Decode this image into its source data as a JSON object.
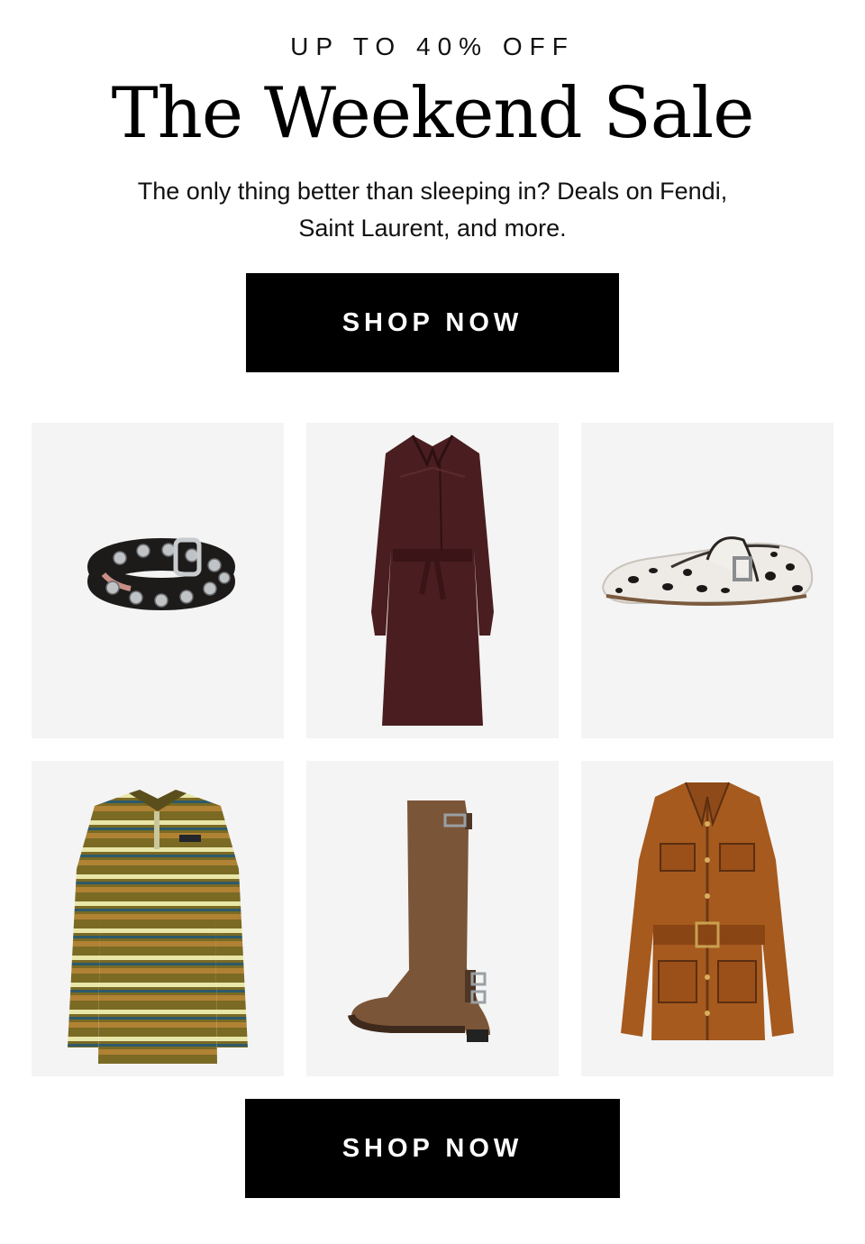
{
  "hero": {
    "eyebrow": "UP TO 40% OFF",
    "title": "The Weekend Sale",
    "subtitle": "The only thing better than sleeping in? Deals on Fendi, Saint Laurent, and more."
  },
  "cta": {
    "top_label": "SHOP NOW",
    "bottom_label": "SHOP NOW"
  },
  "products": [
    {
      "icon": "studded-belt"
    },
    {
      "icon": "leather-trench-coat"
    },
    {
      "icon": "dalmatian-print-mary-jane-shoe"
    },
    {
      "icon": "striped-polo-shirt"
    },
    {
      "icon": "suede-biker-boot"
    },
    {
      "icon": "belted-leather-jacket"
    }
  ],
  "colors": {
    "button_bg": "#000000",
    "tile_bg": "#f4f4f4",
    "text": "#111111"
  }
}
